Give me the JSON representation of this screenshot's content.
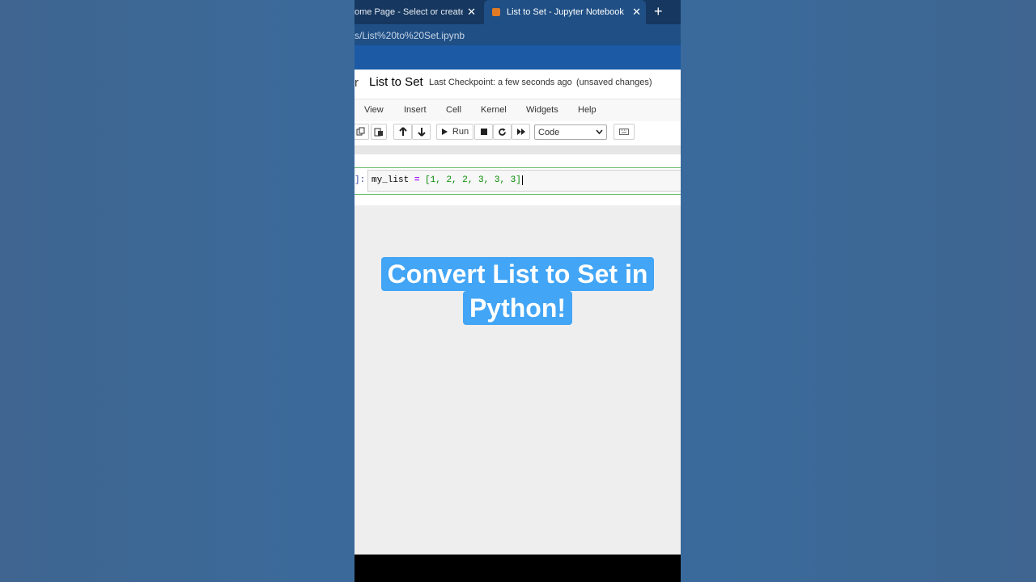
{
  "browser": {
    "tabs": [
      {
        "label": "ome Page - Select or create a n",
        "active": false
      },
      {
        "label": "List to Set - Jupyter Notebook",
        "active": true
      }
    ],
    "url": "s/List%20to%20Set.ipynb"
  },
  "notebook": {
    "title": "List to Set",
    "checkpoint": "Last Checkpoint: a few seconds ago",
    "status": "(unsaved changes)",
    "logo_stub": "r"
  },
  "menu": [
    "View",
    "Insert",
    "Cell",
    "Kernel",
    "Widgets",
    "Help"
  ],
  "toolbar": {
    "run_label": "Run",
    "cell_type": "Code"
  },
  "cell": {
    "prompt": "]:",
    "code_var": "my_list",
    "code_op": "=",
    "code_values": "[1, 2, 2, 3, 3, 3]"
  },
  "caption": {
    "line1": "Convert List to Set in",
    "line2": "Python!"
  },
  "colors": {
    "caption_bg": "#42a5f5",
    "jupyter_blue": "#1c5aa5",
    "cell_border": "#66bb6a"
  }
}
